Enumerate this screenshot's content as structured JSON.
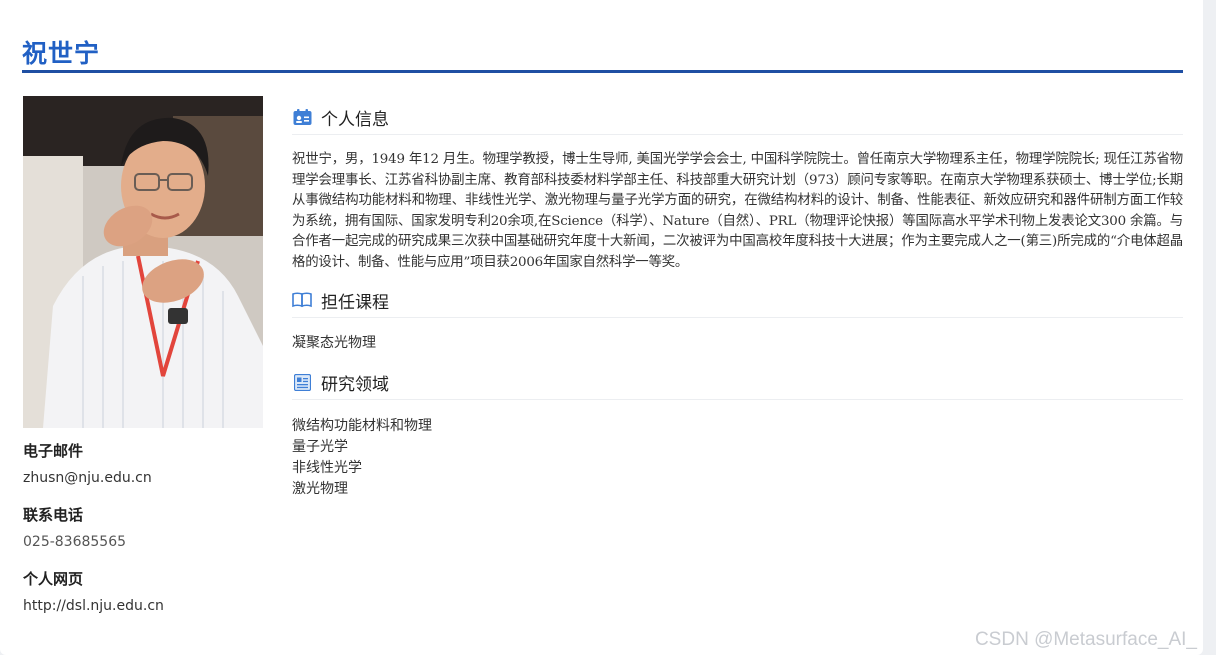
{
  "page": {
    "title": "祝世宁"
  },
  "contact": {
    "email_label": "电子邮件",
    "email": "zhusn@nju.edu.cn",
    "phone_label": "联系电话",
    "phone": "025-83685565",
    "homepage_label": "个人网页",
    "homepage": "http://dsl.nju.edu.cn"
  },
  "sections": {
    "personal": {
      "title": "个人信息",
      "icon": "id-card-icon",
      "text": "祝世宁，男，1949 年12 月生。物理学教授，博士生导师, 美国光学学会会士, 中国科学院院士。曾任南京大学物理系主任，物理学院院长; 现任江苏省物理学会理事长、江苏省科协副主席、教育部科技委材料学部主任、科技部重大研究计划（973）顾问专家等职。在南京大学物理系获硕士、博士学位;长期从事微结构功能材料和物理、非线性光学、激光物理与量子光学方面的研究，在微结构材料的设计、制备、性能表征、新效应研究和器件研制方面工作较为系统，拥有国际、国家发明专利20余项,在Science（科学）、Nature（自然）、PRL（物理评论快报）等国际高水平学术刊物上发表论文300 余篇。与合作者一起完成的研究成果三次获中国基础研究年度十大新闻，二次被评为中国高校年度科技十大进展；作为主要完成人之一(第三)所完成的“介电体超晶格的设计、制备、性能与应用”项目获2006年国家自然科学一等奖。"
    },
    "courses": {
      "title": "担任课程",
      "icon": "book-icon",
      "text": "凝聚态光物理"
    },
    "research": {
      "title": "研究领域",
      "icon": "document-icon",
      "items": [
        "微结构功能材料和物理",
        "量子光学",
        "非线性光学",
        "激光物理"
      ]
    }
  },
  "watermark": "CSDN @Metasurface_AI_",
  "colors": {
    "accent": "#1f4fa3",
    "title": "#2160c4",
    "icon": "#3f7fd6"
  }
}
